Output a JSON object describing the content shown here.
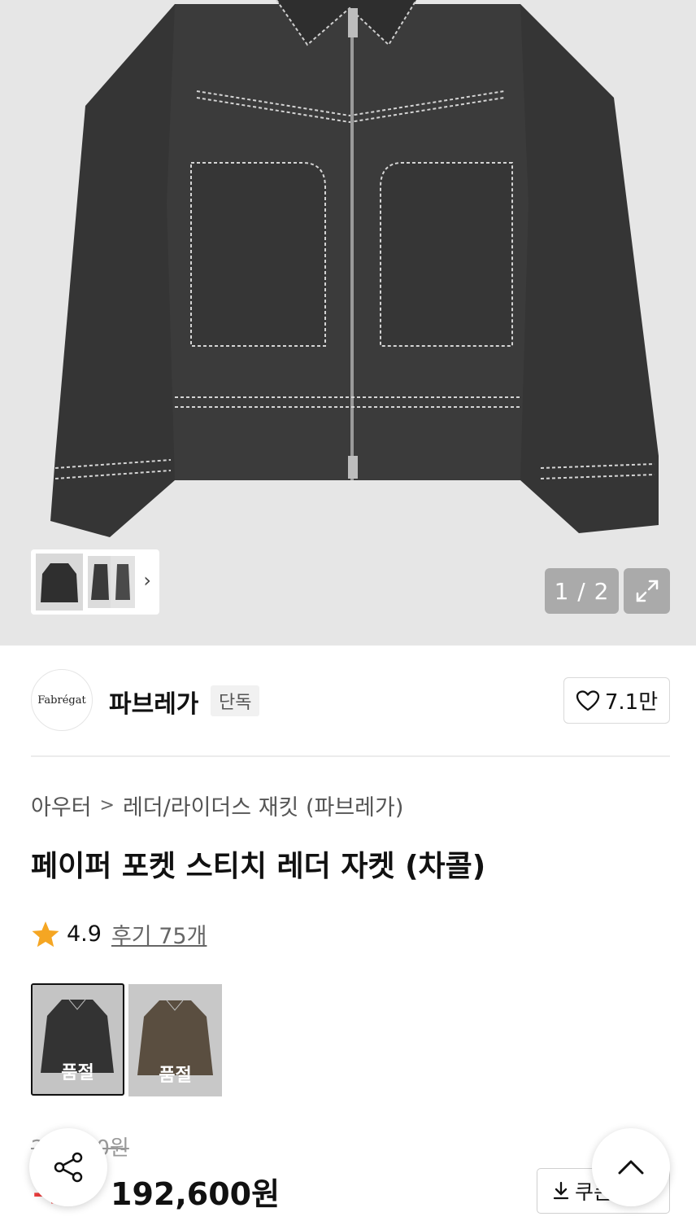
{
  "gallery": {
    "counter": "1 / 2",
    "expand_icon": "expand-arrows-icon",
    "thumb_next_icon": "chevron-right-icon"
  },
  "brand": {
    "logo_text": "Fabrégat",
    "name": "파브레가",
    "badge": "단독",
    "likes": "7.1만",
    "like_icon": "heart-outline-icon"
  },
  "breadcrumb": {
    "level1": "아우터",
    "separator": ">",
    "level2": "레더/라이더스 재킷 (파브레가)"
  },
  "product": {
    "title": "페이퍼 포켓 스티치 레더 자켓 (차콜)",
    "rating": "4.9",
    "reviews": "후기 75개",
    "options": [
      {
        "color": "charcoal",
        "status": "품절",
        "selected": true
      },
      {
        "color": "brown",
        "status": "품절",
        "selected": false
      }
    ],
    "original_price": "2__,_00원",
    "discount": "1_%",
    "sale_price": "192,600원",
    "coupon_label": "쿠폰"
  },
  "colors": {
    "discount_red": "#f03e3e",
    "star": "#f5a623",
    "jacket_body": "#3b3b3b"
  }
}
